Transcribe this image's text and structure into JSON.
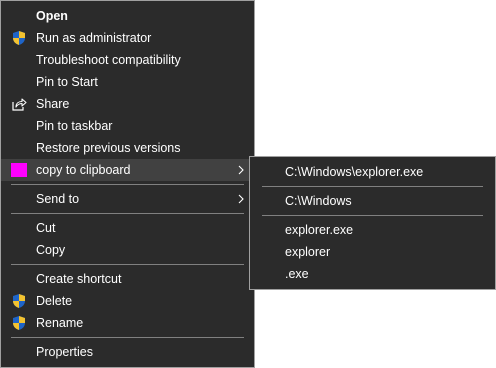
{
  "colors": {
    "menu_background": "#2b2b2b",
    "menu_border": "#a0a0a0",
    "highlight": "#414141",
    "separator": "#808080",
    "swatch": "#ff00ff",
    "text": "#ffffff"
  },
  "context_menu": {
    "items": [
      {
        "label": "Open",
        "bold": true
      },
      {
        "label": "Run as administrator",
        "icon": "uac-shield-icon"
      },
      {
        "label": "Troubleshoot compatibility"
      },
      {
        "label": "Pin to Start"
      },
      {
        "label": "Share",
        "icon": "share-icon"
      },
      {
        "label": "Pin to taskbar"
      },
      {
        "label": "Restore previous versions"
      },
      {
        "label": "copy to clipboard",
        "icon": "color-swatch",
        "submenu": true,
        "highlighted": true
      },
      {
        "label": "Send to",
        "submenu": true
      },
      {
        "label": "Cut"
      },
      {
        "label": "Copy"
      },
      {
        "label": "Create shortcut"
      },
      {
        "label": "Delete",
        "icon": "uac-shield-icon"
      },
      {
        "label": "Rename",
        "icon": "uac-shield-icon"
      },
      {
        "label": "Properties"
      }
    ]
  },
  "submenu": {
    "items": [
      {
        "label": "C:\\Windows\\explorer.exe"
      },
      {
        "label": "C:\\Windows"
      },
      {
        "label": "explorer.exe"
      },
      {
        "label": "explorer"
      },
      {
        "label": ".exe"
      }
    ]
  }
}
